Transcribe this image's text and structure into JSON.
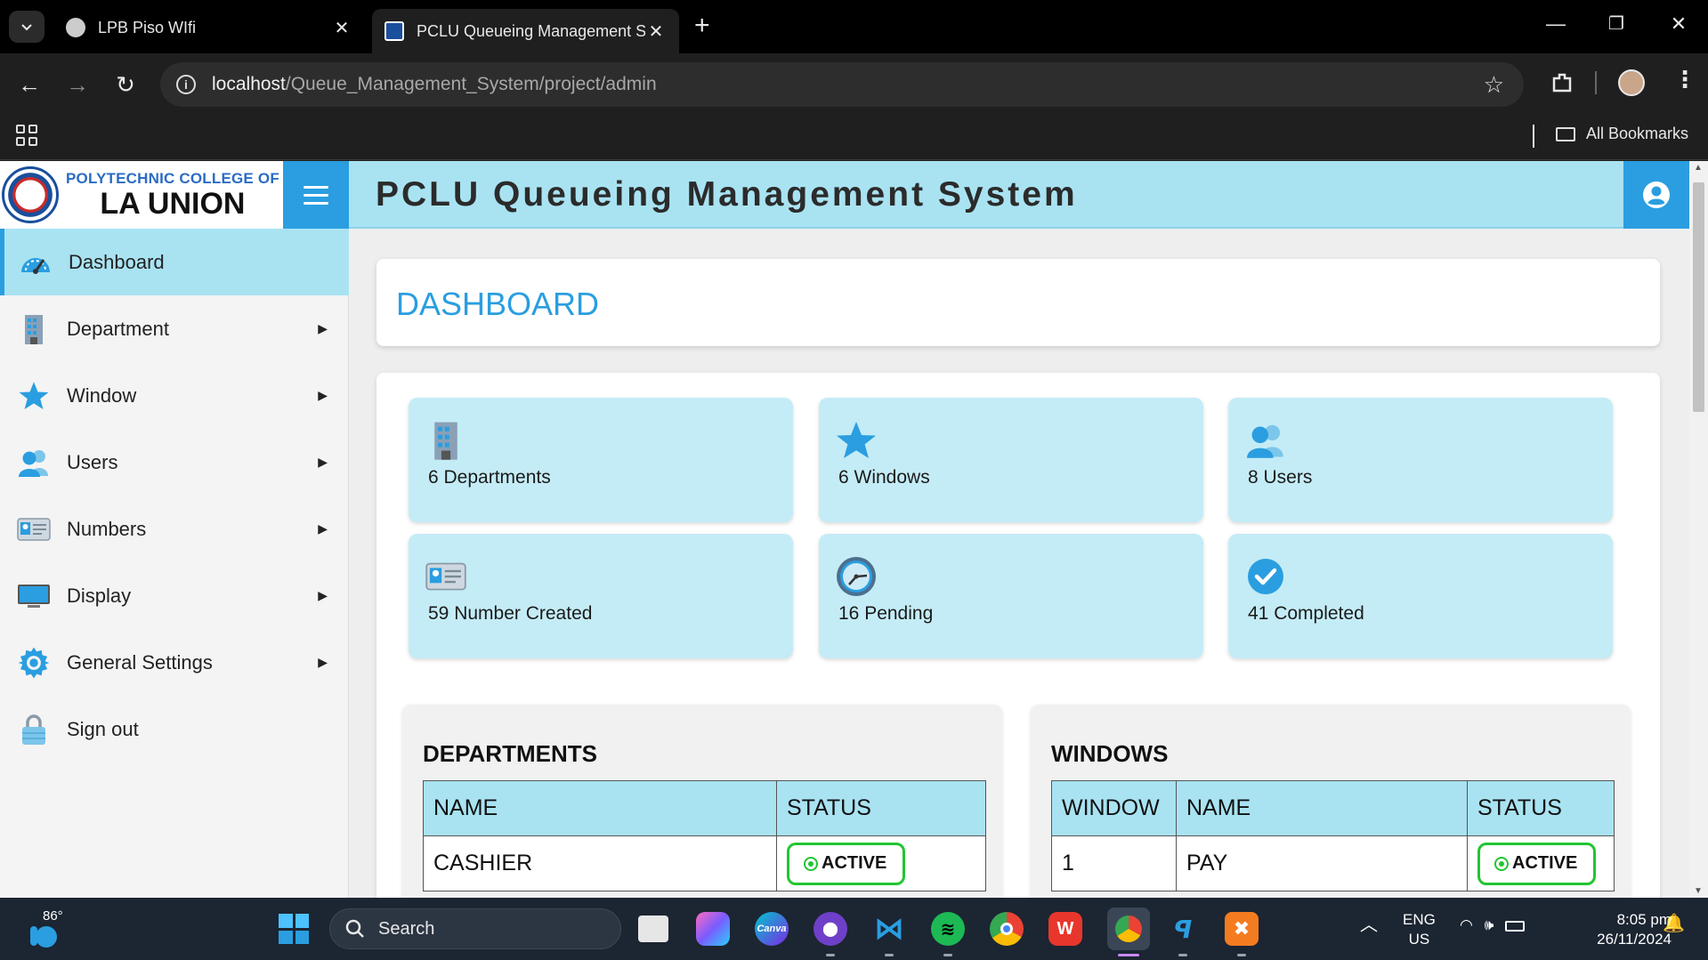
{
  "browser": {
    "tabs": [
      {
        "title": "LPB Piso WIfi",
        "active": false
      },
      {
        "title": "PCLU Queueing Management S",
        "active": true
      }
    ],
    "url_host": "localhost",
    "url_path": "/Queue_Management_System/project/admin",
    "bookmarks_label": "All Bookmarks"
  },
  "header": {
    "brand_line1": "POLYTECHNIC COLLEGE OF",
    "brand_line2": "LA UNION",
    "system_title": "PCLU Queueing Management System"
  },
  "sidebar": {
    "items": [
      {
        "label": "Dashboard",
        "icon": "speedometer-icon",
        "has_submenu": false,
        "active": true
      },
      {
        "label": "Department",
        "icon": "building-icon",
        "has_submenu": true,
        "active": false
      },
      {
        "label": "Window",
        "icon": "star-icon",
        "has_submenu": true,
        "active": false
      },
      {
        "label": "Users",
        "icon": "users-icon",
        "has_submenu": true,
        "active": false
      },
      {
        "label": "Numbers",
        "icon": "id-card-icon",
        "has_submenu": true,
        "active": false
      },
      {
        "label": "Display",
        "icon": "monitor-icon",
        "has_submenu": true,
        "active": false
      },
      {
        "label": "General Settings",
        "icon": "gear-icon",
        "has_submenu": true,
        "active": false
      },
      {
        "label": "Sign out",
        "icon": "lock-icon",
        "has_submenu": false,
        "active": false
      }
    ]
  },
  "dashboard": {
    "title": "DASHBOARD",
    "stats": [
      {
        "label": "6 Departments",
        "icon": "building-icon"
      },
      {
        "label": "6 Windows",
        "icon": "star-icon"
      },
      {
        "label": "8 Users",
        "icon": "users-icon"
      },
      {
        "label": "59 Number Created",
        "icon": "id-card-icon"
      },
      {
        "label": "16 Pending",
        "icon": "clock-icon"
      },
      {
        "label": "41 Completed",
        "icon": "check-circle-icon"
      }
    ]
  },
  "departments": {
    "title": "DEPARTMENTS",
    "columns": [
      "NAME",
      "STATUS"
    ],
    "rows": [
      {
        "name": "CASHIER",
        "status": "ACTIVE"
      }
    ]
  },
  "windows": {
    "title": "WINDOWS",
    "columns": [
      "WINDOW",
      "NAME",
      "STATUS"
    ],
    "rows": [
      {
        "window": "1",
        "name": "PAY",
        "status": "ACTIVE"
      }
    ]
  },
  "taskbar": {
    "temperature": "86°",
    "search_placeholder": "Search",
    "language_line1": "ENG",
    "language_line2": "US",
    "time": "8:05 pm",
    "date": "26/11/2024"
  },
  "colors": {
    "accent": "#2a9ee0",
    "light_blue": "#a9e3f2",
    "stat_card": "#c4ecf6",
    "active_green": "#22c531"
  }
}
